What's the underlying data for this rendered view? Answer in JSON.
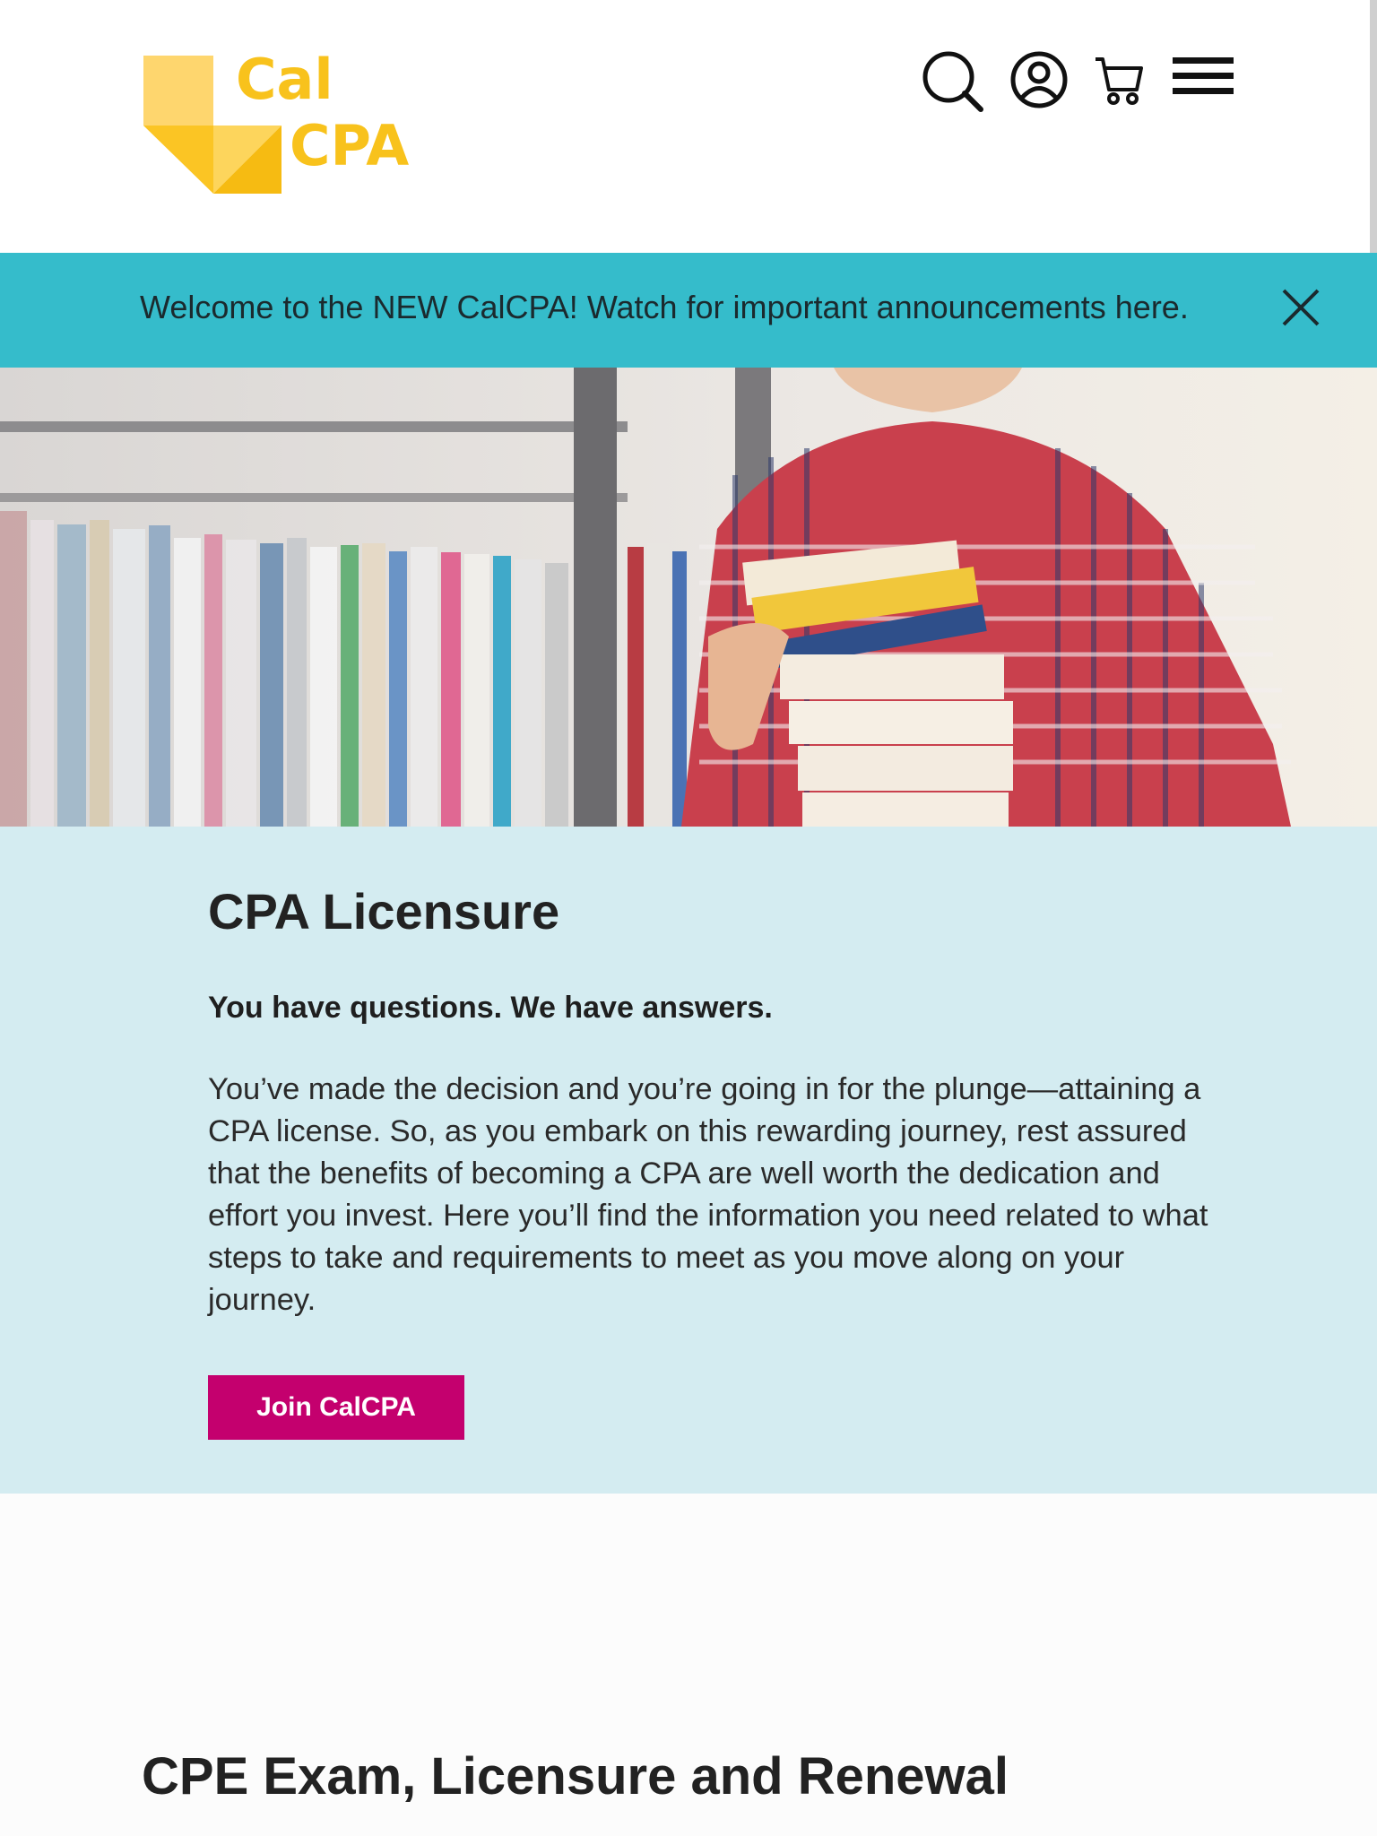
{
  "header": {
    "logo": {
      "line1": "Cal",
      "line2": "CPA"
    },
    "icons": [
      "search-icon",
      "account-icon",
      "cart-icon",
      "menu-icon"
    ]
  },
  "announcement": {
    "text": "Welcome to the NEW CalCPA! Watch for important announcements here.",
    "close_icon": "close-icon"
  },
  "hero": {
    "image": "student-holding-books-in-library"
  },
  "licensure": {
    "title": "CPA Licensure",
    "subtitle": "You have questions. We have answers.",
    "body": "You’ve made the decision and you’re going in for the plunge—attaining a CPA license. So, as you embark on this rewarding journey, rest assured that the benefits of becoming a CPA are well worth the dedication and effort you invest. Here you’ll find the information you need related to what steps to take and requirements to meet as you move along on your journey.",
    "button": "Join CalCPA"
  },
  "next_section": {
    "title": "CPE Exam, Licensure and Renewal"
  },
  "colors": {
    "brand_yellow": "#f8c21c",
    "announcement_bg": "#35bccb",
    "section_bg": "#d4ecf1",
    "button_bg": "#c4006e"
  }
}
